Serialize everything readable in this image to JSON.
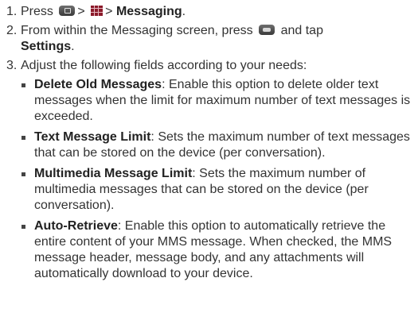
{
  "steps": [
    {
      "num": "1.",
      "text_press": "Press",
      "sep1": ">",
      "sep2": ">",
      "bold": "Messaging",
      "end": "."
    },
    {
      "num": "2.",
      "text_a": "From within the Messaging screen, press",
      "text_b": "and tap",
      "bold": "Settings",
      "end": "."
    },
    {
      "num": "3.",
      "text": "Adjust the following fields according to your needs:"
    }
  ],
  "options": [
    {
      "name": "Delete Old Messages",
      "desc": ": Enable this option to delete older text messages when the limit for maximum number of text messages is exceeded."
    },
    {
      "name": "Text Message Limit",
      "desc": ": Sets the maximum number of text messages that can be stored on the device (per conversation)."
    },
    {
      "name": "Multimedia Message Limit",
      "desc": ": Sets the maximum number of multimedia messages that can be stored on the device (per conversation)."
    },
    {
      "name": "Auto-Retrieve",
      "desc": ": Enable this option to automatically retrieve the entire content of your MMS message. When checked, the MMS message header, message body, and any attachments will automatically download to your device."
    }
  ],
  "icons": {
    "home_key": "home-key-icon",
    "applications": "applications-grid-icon",
    "menu_key": "menu-key-icon"
  }
}
